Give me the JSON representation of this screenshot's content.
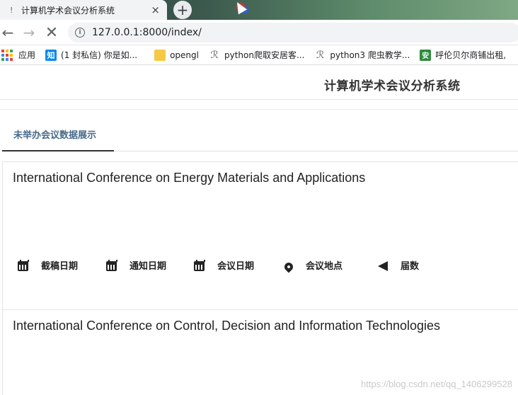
{
  "browser": {
    "tab": {
      "title": "计算机学术会议分析系统",
      "favicon": "!",
      "close": "×"
    },
    "new_tab": "+",
    "nav": {
      "back": "←",
      "forward": "→",
      "stop": "✕"
    },
    "url": "127.0.0.1:8000/index/",
    "info": "i",
    "bookmarks": [
      {
        "label": "应用",
        "icon": "apps-icon"
      },
      {
        "label": "(1 封私信) 你是如...",
        "icon": "zhihu-icon",
        "glyph": "知"
      },
      {
        "label": "opengl",
        "icon": "folder-icon"
      },
      {
        "label": "python爬取安居客...",
        "icon": "spider-icon",
        "glyph": "ℛ"
      },
      {
        "label": "python3 爬虫教学...",
        "icon": "spider-icon",
        "glyph": "ℛ"
      },
      {
        "label": "呼伦贝尔商铺出租,",
        "icon": "anjuke-icon",
        "glyph": "安"
      }
    ]
  },
  "site": {
    "title": "计算机学术会议分析系统",
    "tab_label": "未举办会议数据展示"
  },
  "conferences": [
    {
      "name": "International Conference on Energy Materials and Applications",
      "meta": [
        "截稿日期",
        "通知日期",
        "会议日期",
        "会议地点",
        "届数"
      ]
    },
    {
      "name": "International Conference on Control, Decision and Information Technologies"
    }
  ],
  "watermark": "https://blog.csdn.net/qq_1406299528",
  "colors": {
    "accent": "#486a8a",
    "title": "#333333"
  }
}
